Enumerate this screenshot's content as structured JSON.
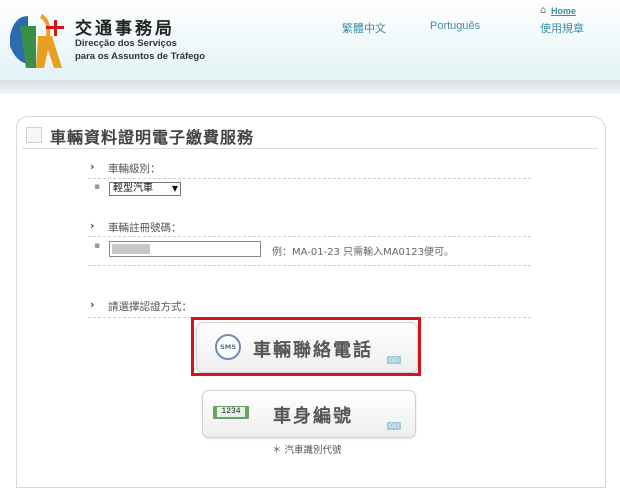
{
  "header": {
    "org_name_cn": "交通事務局",
    "org_name_pt_line1": "Direcção dos Serviços",
    "org_name_pt_line2": "para os Assuntos de Tráfego",
    "nav": [
      "繁體中文",
      "Português",
      "使用規章"
    ],
    "home_label": "Home"
  },
  "page": {
    "title": "車輛資料證明電子繳費服務"
  },
  "form": {
    "vehicle_type": {
      "label": "車輛級別：",
      "selected": "輕型汽車"
    },
    "plate": {
      "label": "車輛註冊號碼：",
      "value": "",
      "hint": "例：MA-01-23 只需輸入MA0123便可。"
    },
    "verify": {
      "label": "請選擇認證方式："
    }
  },
  "buttons": {
    "sms": {
      "label": "車輛聯絡電話",
      "icon_text": "SMS",
      "badge": "GO"
    },
    "vin": {
      "label": "車身編號",
      "icon_text": "1234",
      "badge": "GO"
    }
  },
  "footnote": "＊ 汽車識別代號",
  "colors": {
    "accent": "#3f8ea8",
    "highlight": "#d4141c",
    "title_bar": "#e3f2f5"
  }
}
